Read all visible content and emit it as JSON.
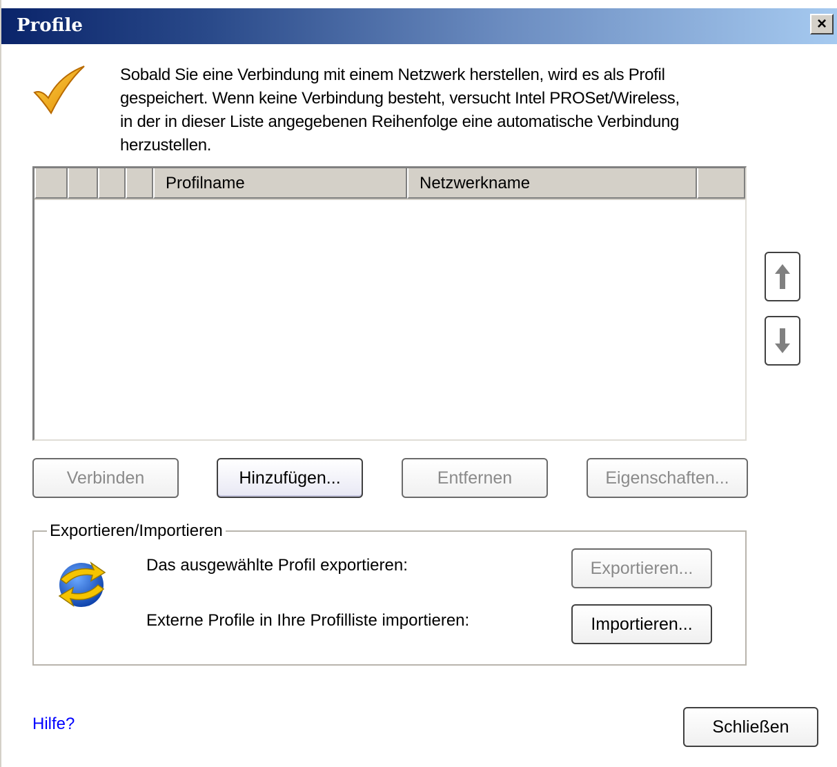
{
  "window": {
    "title": "Profile",
    "close_label": "×"
  },
  "intro": {
    "lines": [
      "Sobald Sie eine Verbindung mit einem Netzwerk herstellen, wird es als Profil",
      "gespeichert. Wenn keine Verbindung besteht, versucht Intel PROSet/Wireless,",
      "in der in dieser Liste angegebenen Reihenfolge eine automatische Verbindung",
      "herzustellen."
    ]
  },
  "profile_list": {
    "columns": [
      "",
      "",
      "",
      "",
      "Profilname",
      "Netzwerkname",
      ""
    ],
    "rows": []
  },
  "reorder": {
    "up_icon": "arrow-up-icon",
    "down_icon": "arrow-down-icon"
  },
  "actions": {
    "connect_label": "Verbinden",
    "add_label": "Hinzufügen...",
    "remove_label": "Entfernen",
    "properties_label": "Eigenschaften..."
  },
  "export_import": {
    "group_title": "Exportieren/Importieren",
    "export_text": "Das ausgewählte Profil exportieren:",
    "export_label": "Exportieren...",
    "import_text": "Externe Profile in Ihre Profilliste importieren:",
    "import_label": "Importieren..."
  },
  "footer": {
    "help_label": "Hilfe?",
    "close_label": "Schließen"
  },
  "colors": {
    "titlebar_start": "#0a246a",
    "titlebar_end": "#a6caf0",
    "link": "#0000ff",
    "disabled_text": "#8a8a8a"
  }
}
